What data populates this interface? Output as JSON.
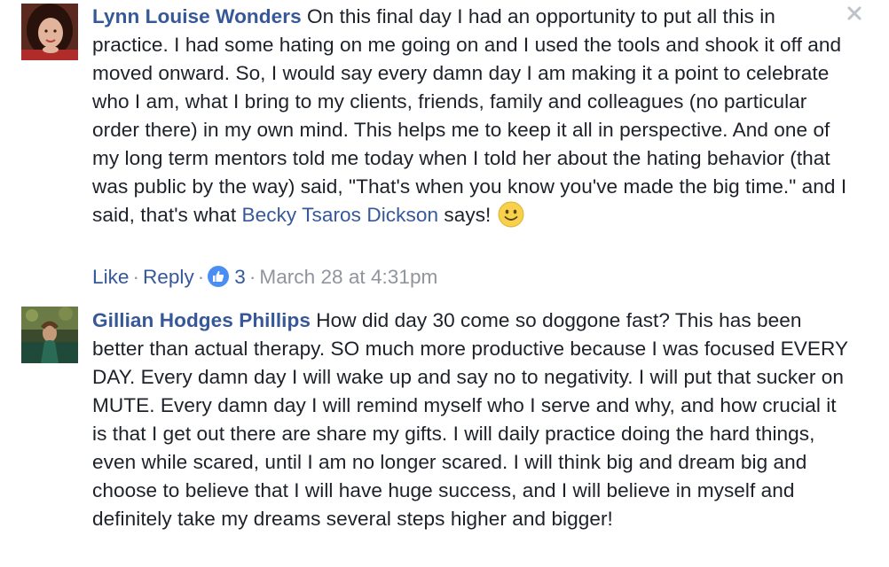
{
  "comments": [
    {
      "author": "Lynn Louise Wonders",
      "text": "On this final day I had an opportunity to put all this in practice. I had some hating on me going on and I used the tools and shook it off and moved onward. So, I would say every damn day I am making it a point to celebrate who I am, what I bring to my clients, friends, family and colleagues (no particular order there) in my own mind. This helps me to keep it all in perspective. And one of my long term mentors told me today when I told her about the hating behavior (that was public by the way) said, \"That's when you know you've made the big time.\" and I said, that's what",
      "mention": "Becky Tsaros Dickson",
      "text_after": "says!",
      "emoji": "smiley-icon",
      "actions": {
        "like_label": "Like",
        "reply_label": "Reply",
        "reaction_count": "3",
        "timestamp": "March 28 at 4:31pm"
      }
    },
    {
      "author": "Gillian Hodges Phillips",
      "text": "How did day 30 come so doggone fast? This has been better than actual therapy. SO much more productive because I was focused EVERY DAY. Every damn day I will wake up and say no to negativity. I will put that sucker on MUTE. Every damn day I will remind myself who I serve and why, and how crucial it is that I get out there are share my gifts. I will daily practice doing the hard things, even while scared, until I am no longer scared. I will think big and dream big and choose to believe that I will have huge success, and I will believe in myself and definitely take my dreams several steps higher and bigger!"
    }
  ],
  "icons": {
    "close": "close-icon",
    "reaction": "like-reaction-icon",
    "emoji": "smiley-icon"
  },
  "colors": {
    "link": "#365899",
    "meta": "#90949c",
    "text": "#1d2129",
    "like_blue": "#4a8ef2",
    "emoji_yellow": "#f7d14c"
  }
}
